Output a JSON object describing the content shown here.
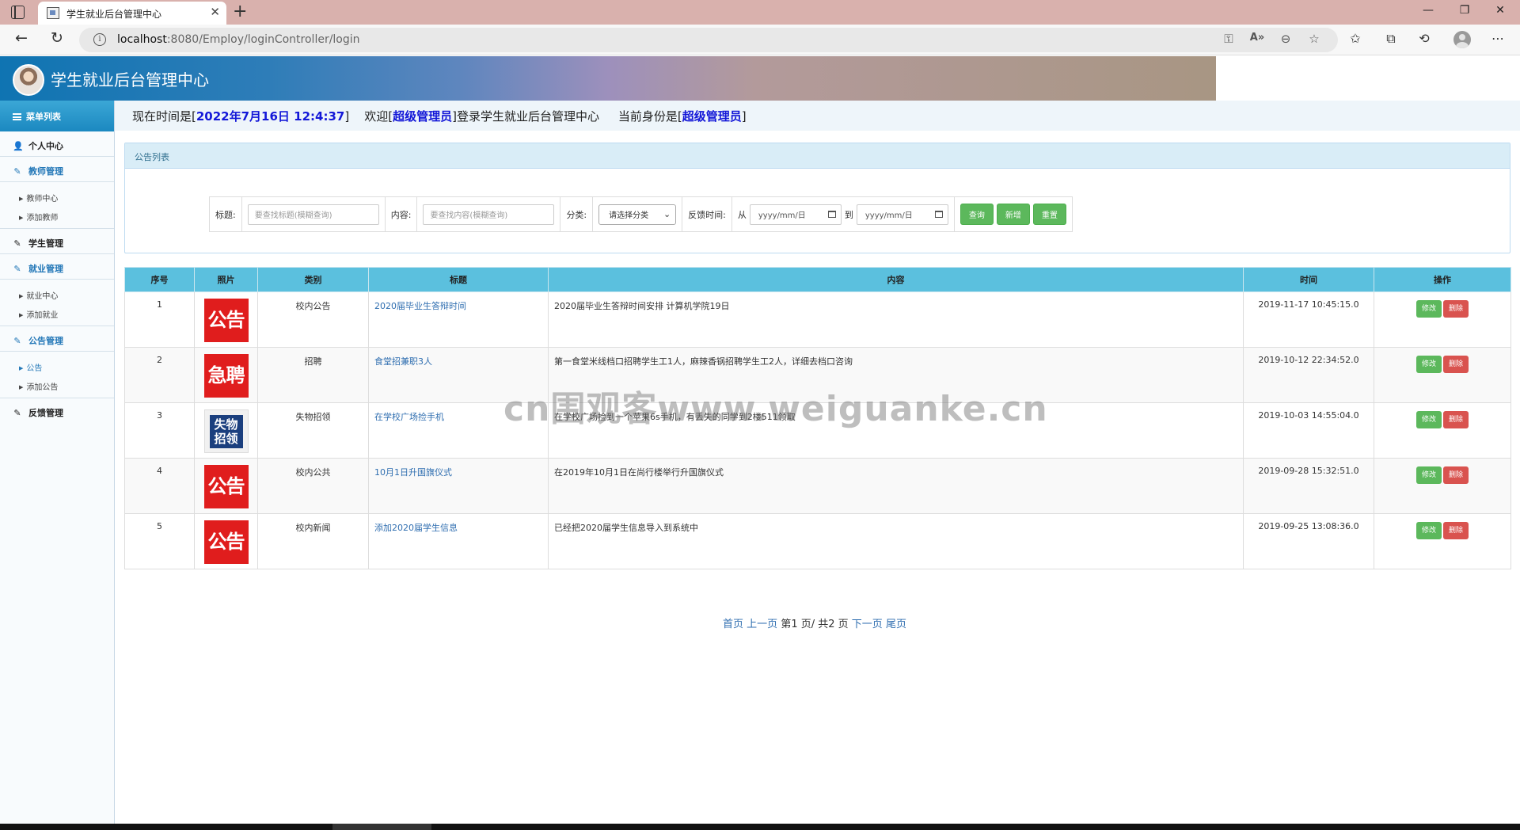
{
  "browser": {
    "tab_title": "学生就业后台管理中心",
    "url_host": "localhost",
    "url_rest": ":8080/Employ/loginController/login"
  },
  "app": {
    "title": "学生就业后台管理中心"
  },
  "sidebar": {
    "header": "菜单列表",
    "personal": "个人中心",
    "teacher_mgmt": "教师管理",
    "teacher_items": [
      "教师中心",
      "添加教师"
    ],
    "student_mgmt": "学生管理",
    "employ_mgmt": "就业管理",
    "employ_items": [
      "就业中心",
      "添加就业"
    ],
    "notice_mgmt": "公告管理",
    "notice_items": [
      "公告",
      "添加公告"
    ],
    "feedback_mgmt": "反馈管理"
  },
  "info": {
    "time_prefix": "现在时间是[",
    "time_value": "2022年7月16日 12:4:37",
    "time_suffix": "]",
    "welcome_prefix": "欢迎[",
    "welcome_user": "超级管理员",
    "welcome_suffix": "]登录学生就业后台管理中心",
    "role_prefix": "当前身份是[",
    "role_value": "超级管理员",
    "role_suffix": "]"
  },
  "panel": {
    "title": "公告列表",
    "search": {
      "title_label": "标题:",
      "title_placeholder": "要查找标题(模糊查询)",
      "content_label": "内容:",
      "content_placeholder": "要查找内容(模糊查询)",
      "category_label": "分类:",
      "category_selected": "请选择分类",
      "time_label": "反馈时间:",
      "from": "从",
      "to": "到",
      "date_placeholder": "yyyy/mm/日",
      "query_btn": "查询",
      "add_btn": "新增",
      "reset_btn": "重置"
    }
  },
  "table": {
    "headers": [
      "序号",
      "照片",
      "类别",
      "标题",
      "内容",
      "时间",
      "操作"
    ],
    "edit_label": "修改",
    "delete_label": "删除",
    "rows": [
      {
        "no": "1",
        "photo": "公告",
        "category": "校内公告",
        "title": "2020届毕业生答辩时间",
        "content": "2020届毕业生答辩时间安排 计算机学院19日",
        "time": "2019-11-17 10:45:15.0"
      },
      {
        "no": "2",
        "photo": "急聘",
        "category": "招聘",
        "title": "食堂招兼职3人",
        "content": "第一食堂米线档口招聘学生工1人，麻辣香锅招聘学生工2人，详细去档口咨询",
        "time": "2019-10-12 22:34:52.0"
      },
      {
        "no": "3",
        "photo": "失物招领",
        "category": "失物招领",
        "title": "在学校广场捡手机",
        "content": "在学校广场捡到一个苹果6s手机，有丢失的同学到2楼511领取",
        "time": "2019-10-03 14:55:04.0"
      },
      {
        "no": "4",
        "photo": "公告",
        "category": "校内公共",
        "title": "10月1日升国旗仪式",
        "content": "在2019年10月1日在尚行楼举行升国旗仪式",
        "time": "2019-09-28 15:32:51.0"
      },
      {
        "no": "5",
        "photo": "公告",
        "category": "校内新闻",
        "title": "添加2020届学生信息",
        "content": "已经把2020届学生信息导入到系统中",
        "time": "2019-09-25 13:08:36.0"
      }
    ]
  },
  "pager": {
    "first": "首页",
    "prev": "上一页",
    "status": "第1 页/ 共2 页",
    "next": "下一页",
    "last": "尾页"
  },
  "watermark": "cn围观客www.weiguanke.cn"
}
